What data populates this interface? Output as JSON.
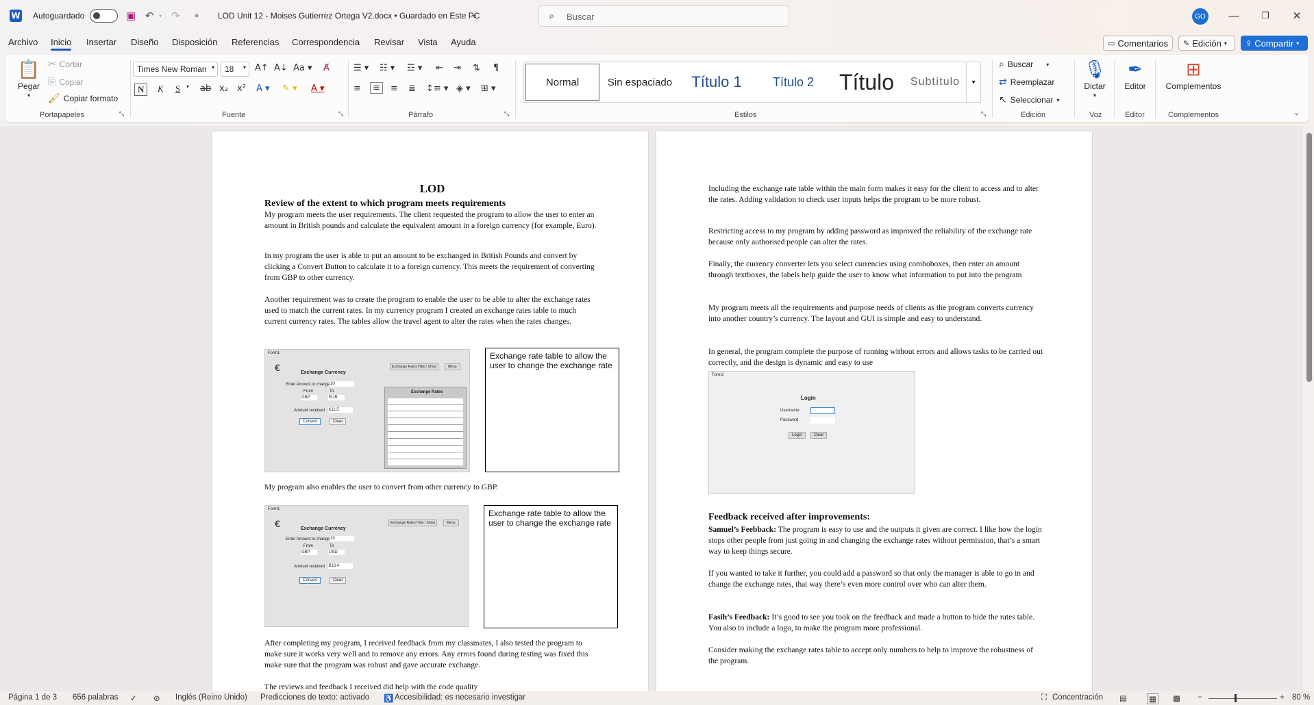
{
  "app": {
    "autosave_label": "Autoguardado",
    "doc_title": "LOD Unit 12 - Moises Gutierrez Ortega V2.docx • Guardado en Este PC",
    "search_placeholder": "Buscar",
    "avatar_initials": "GO",
    "accent": "#185abd"
  },
  "menu": {
    "tabs": [
      "Archivo",
      "Inicio",
      "Insertar",
      "Diseño",
      "Disposición",
      "Referencias",
      "Correspondencia",
      "Revisar",
      "Vista",
      "Ayuda"
    ],
    "comments": "Comentarios",
    "editing": "Edición",
    "share": "Compartir"
  },
  "ribbon": {
    "clipboard": {
      "paste": "Pegar",
      "cut": "Cortar",
      "copy": "Copiar",
      "format_painter": "Copiar formato",
      "label": "Portapapeles"
    },
    "font": {
      "family": "Times New Roman",
      "size": "18",
      "label": "Fuente",
      "case": "Aa",
      "bold": "N",
      "italic": "K",
      "underline": "S",
      "strike": "ab",
      "sub": "x₂",
      "sup": "x²"
    },
    "paragraph": {
      "label": "Párrafo"
    },
    "styles": {
      "items": [
        "Normal",
        "Sin espaciado",
        "Título 1",
        "Título 2",
        "Título",
        "Subtítulo"
      ],
      "label": "Estilos"
    },
    "editing": {
      "find": "Buscar",
      "replace": "Reemplazar",
      "select": "Seleccionar",
      "label": "Edición"
    },
    "voice": {
      "dictate": "Dictar",
      "label": "Voz"
    },
    "editor": {
      "editor": "Editor",
      "label": "Editor"
    },
    "addins": {
      "addins": "Complementos",
      "label": "Complementos"
    }
  },
  "page1": {
    "title": "LOD",
    "heading": "Review of the extent to which program meets requirements",
    "p1": "My program meets the user requirements. The client requested the program to allow the user to enter an amount in British pounds and calculate the equivalent amount in a foreign currency (for example, Euro).",
    "p2": "In my program the user is able to put an amount to be exchanged in British Pounds and convert by clicking a Convert Button to calculate it to a foreign currency. This meets the requirement of converting from GBP to other currency.",
    "p3": "Another requirement was to create the program to enable the user to be able to alter the exchange rates used to match the current rates. In my currency program I created an exchange rates table to much current currency rates. The tables allow the travel agent to alter the rates when the rates changes.",
    "callout1": "Exchange rate table to allow the user to change the exchange rate",
    "p4": "My program also enables the user to convert from other currency to GBP.",
    "callout2": "Exchange rate table to allow the user to change the exchange rate",
    "p5": "After completing my program, I received feedback from my classmates, I also tested the program to make sure it works very well and to remove any errors. Any errors found during testing was fixed this make sure that the program was robust and gave accurate exchange.",
    "p6": "The reviews and feedback I received did help with the code quality",
    "shot": {
      "form_title": "Form1",
      "app_title": "Exchange Currency",
      "enter_label": "Enter Amount to change",
      "amount1": "10",
      "from": "From",
      "to": "To",
      "from1": "GBP",
      "to1": "EUR",
      "received": "Amount received",
      "result1": "€11.5",
      "convert": "Convert",
      "clear": "Clear",
      "toggle": "Exchange Rates Hide / Show",
      "menu": "Menu",
      "rates_title": "Exchange Rates",
      "amount2": "10",
      "from2": "GBP",
      "to2": "USD",
      "result2": "$13.4"
    }
  },
  "page2": {
    "p1": "Including the exchange rate table within the main form makes it easy for the client to access and to alter the rates. Adding validation to check user inputs helps the program to be more robust.",
    "p2": "Restricting access to my program by adding password as improved the reliability of the exchange rate because only authorised people can alter the rates.",
    "p3": "Finally, the currency converter lets you select currencies using comboboxes, then enter an amount through textboxes, the labels help guide the user to know what information to put into the program",
    "p4": "My program meets all the requirements and purpose needs of clients as the program converts currency into another country’s currency. The layout and GUI is simple and easy to understand.",
    "p5": "In general, the program complete the purpose of running without errors and allows tasks to be carried out correctly, and the design is dynamic and easy to use",
    "login": {
      "form_title": "Form2",
      "title": "Login",
      "username": "Username",
      "password": "Password",
      "login_btn": "Login",
      "clear_btn": "Clear"
    },
    "fb_heading": "Feedback received after improvements:",
    "fb1_name": "Samuel’s Feebback:",
    "fb1": "The program is easy to use and the outputs it given are correct. I like how the login stops other people from just going in and changing the exchange rates without permission, that’s a smart way to keep things secure.",
    "p6": "If you wanted to take it further, you could add a password so that only the manager is able to go in and change the exchange rates, that way there’s even more control over who can alter them.",
    "fb2_name": "Fasih’s Feedback:",
    "fb2": "It’s good to see you took on the feedback and made a button to hide the rates table. You also to include a logo, to make the program more professional.",
    "p7": "Consider making the exchange rates table to accept only numbers to help to improve the robustness of the program."
  },
  "status": {
    "page": "Página 1 de 3",
    "words": "656 palabras",
    "language": "Inglés (Reino Unido)",
    "predictions": "Predicciones de texto: activado",
    "accessibility": "Accesibilidad: es necesario investigar",
    "focus": "Concentración",
    "zoom": "80 %"
  }
}
